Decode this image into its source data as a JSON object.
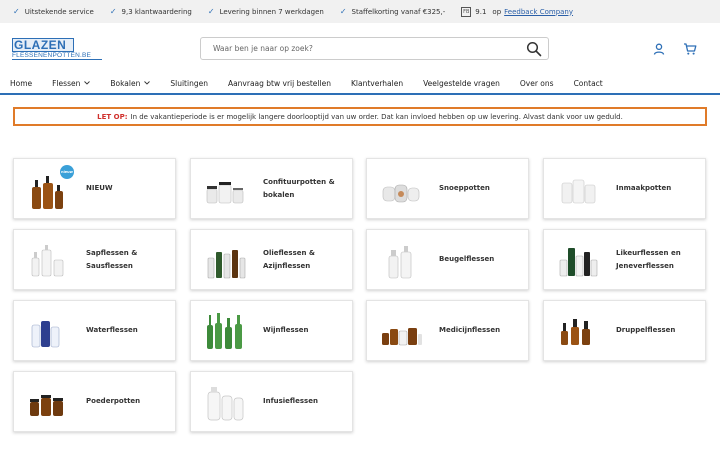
{
  "topbar": {
    "usps": [
      "Uitstekende service",
      "9,3 klantwaardering",
      "Levering binnen 7 werkdagen",
      "Staffelkorting vanaf €325,-"
    ],
    "rating": "9.1",
    "rating_prefix": "op",
    "rating_link": "Feedback Company",
    "rating_logo": "FB"
  },
  "header": {
    "logo_top": "GLAZEN",
    "logo_bottom": "FLESSENENPOTTEN.BE",
    "search_placeholder": "Waar ben je naar op zoek?",
    "icons": [
      "search-icon",
      "user-icon",
      "cart-icon"
    ]
  },
  "nav": {
    "items": [
      {
        "label": "Home",
        "dropdown": false
      },
      {
        "label": "Flessen",
        "dropdown": true
      },
      {
        "label": "Bokalen",
        "dropdown": true
      },
      {
        "label": "Sluitingen",
        "dropdown": false
      },
      {
        "label": "Aanvraag btw vrij bestellen",
        "dropdown": false
      },
      {
        "label": "Klantverhalen",
        "dropdown": false
      },
      {
        "label": "Veelgestelde vragen",
        "dropdown": false
      },
      {
        "label": "Over ons",
        "dropdown": false
      },
      {
        "label": "Contact",
        "dropdown": false
      }
    ]
  },
  "notice": {
    "strong": "LET OP:",
    "text": "In de vakantieperiode is er mogelijk langere doorlooptijd van uw order. Dat kan invloed hebben op uw levering. Alvast dank voor uw geduld."
  },
  "colors": {
    "accent": "#2d6fb6",
    "notice_border": "#e07b29",
    "notice_strong": "#d0312d"
  },
  "categories": [
    {
      "label": "NIEUW",
      "badge": "nieuw",
      "thumb": "amber-pump-bottles"
    },
    {
      "label": "Confituurpotten & bokalen",
      "thumb": "jam-jars"
    },
    {
      "label": "Snoeppotten",
      "thumb": "candy-jars"
    },
    {
      "label": "Inmaakpotten",
      "thumb": "preserving-jars"
    },
    {
      "label": "Sapflessen & Sausflessen",
      "thumb": "juice-bottles"
    },
    {
      "label": "Olieflessen & Azijnflessen",
      "thumb": "oil-bottles"
    },
    {
      "label": "Beugelflessen",
      "thumb": "swing-top-bottles"
    },
    {
      "label": "Likeurflessen en Jeneverflessen",
      "thumb": "liqueur-bottles"
    },
    {
      "label": "Waterflessen",
      "thumb": "water-bottles"
    },
    {
      "label": "Wijnflessen",
      "thumb": "wine-bottles"
    },
    {
      "label": "Medicijnflessen",
      "thumb": "medicine-bottles"
    },
    {
      "label": "Druppelflessen",
      "thumb": "dropper-bottles"
    },
    {
      "label": "Poederpotten",
      "thumb": "powder-jars"
    },
    {
      "label": "Infusieflessen",
      "thumb": "infusion-bottles"
    }
  ]
}
